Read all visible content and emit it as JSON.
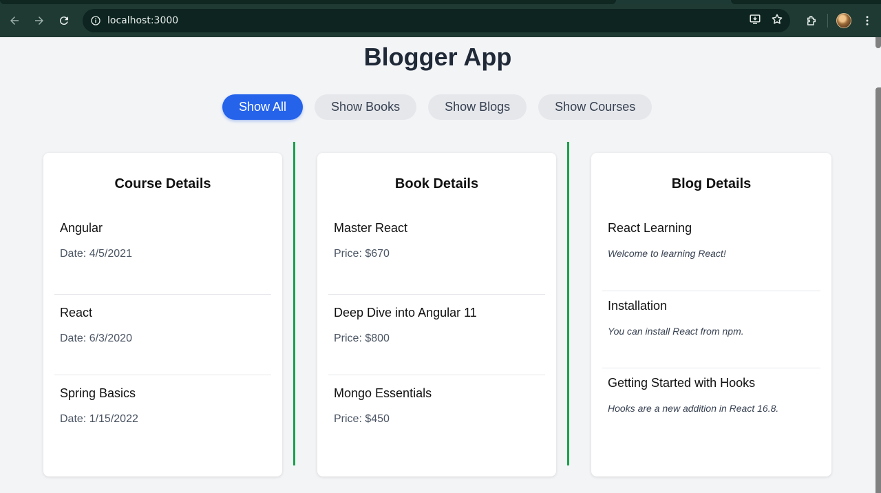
{
  "browser": {
    "url": "localhost:3000"
  },
  "app": {
    "title": "Blogger App"
  },
  "filters": [
    {
      "label": "Show All",
      "active": true
    },
    {
      "label": "Show Books",
      "active": false
    },
    {
      "label": "Show Blogs",
      "active": false
    },
    {
      "label": "Show Courses",
      "active": false
    }
  ],
  "courses": {
    "heading": "Course Details",
    "items": [
      {
        "name": "Angular",
        "date": "Date: 4/5/2021"
      },
      {
        "name": "React",
        "date": "Date: 6/3/2020"
      },
      {
        "name": "Spring Basics",
        "date": "Date: 1/15/2022"
      }
    ]
  },
  "books": {
    "heading": "Book Details",
    "items": [
      {
        "name": "Master React",
        "price": "Price: $670"
      },
      {
        "name": "Deep Dive into Angular 11",
        "price": "Price: $800"
      },
      {
        "name": "Mongo Essentials",
        "price": "Price: $450"
      }
    ]
  },
  "blogs": {
    "heading": "Blog Details",
    "items": [
      {
        "title": "React Learning",
        "content": "Welcome to learning React!"
      },
      {
        "title": "Installation",
        "content": "You can install React from npm."
      },
      {
        "title": "Getting Started with Hooks",
        "content": "Hooks are a new addition in React 16.8."
      }
    ]
  },
  "colors": {
    "accent": "#2563eb",
    "divider": "#16a34a"
  }
}
